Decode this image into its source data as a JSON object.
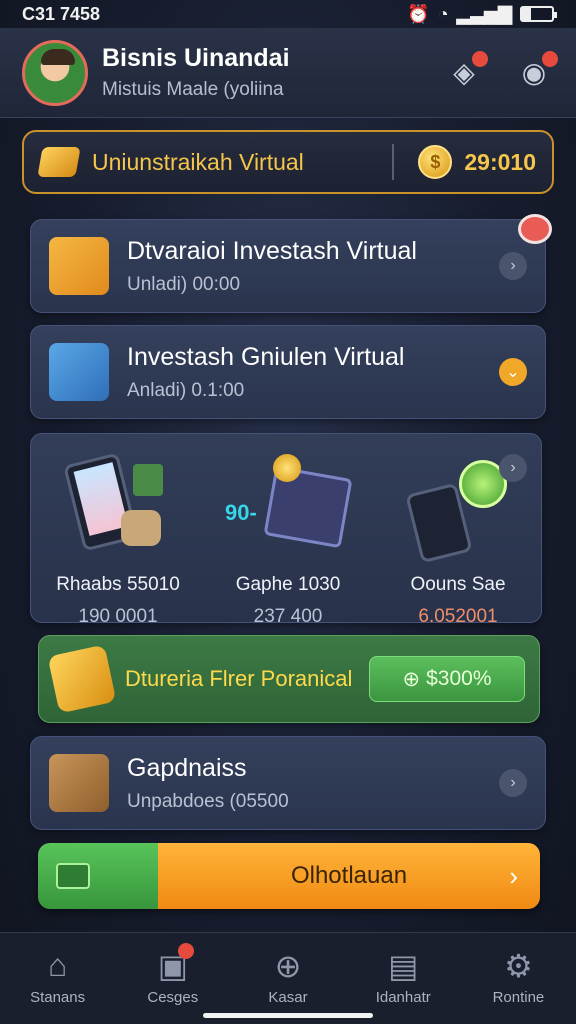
{
  "status": {
    "time": "C31 7458"
  },
  "header": {
    "title": "Bisnis Uinandai",
    "subtitle": "Mistuis Maale (yoliina"
  },
  "balance": {
    "label": "Uniunstraikah Virtual",
    "value": "29:010"
  },
  "cards": [
    {
      "title": "Dtvaraioi Investash Virtual",
      "sub": "Unladi) 00:00"
    },
    {
      "title": "Investash Gniulen Virtual",
      "sub": "Anladi) 0.1:00"
    }
  ],
  "grid": [
    {
      "title": "Rhaabs 55010",
      "value": "190 0001"
    },
    {
      "title": "Gaphe 1030",
      "value": "237 400"
    },
    {
      "title": "Oouns Sae",
      "value": "6.052001"
    }
  ],
  "grid_decor": {
    "equation": "90-"
  },
  "promo": {
    "label": "Dtureria Flrer Poranical",
    "button": "$300%"
  },
  "goals": {
    "title": "Gapdnaiss",
    "sub": "Unpabdoes (05500"
  },
  "cta": {
    "label": "Olhotlauan"
  },
  "nav": [
    {
      "label": "Stanans",
      "icon": "home-icon"
    },
    {
      "label": "Cesges",
      "icon": "box-icon"
    },
    {
      "label": "Kasar",
      "icon": "pin-icon"
    },
    {
      "label": "Idanhatr",
      "icon": "chart-icon"
    },
    {
      "label": "Rontine",
      "icon": "gear-icon"
    }
  ],
  "colors": {
    "accent": "#f6c54b",
    "promo": "#3d7a45",
    "cta": "#f08a12",
    "badge": "#e64a3c"
  }
}
